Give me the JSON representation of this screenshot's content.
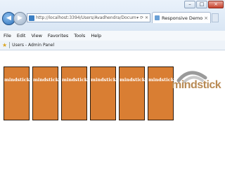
{
  "browser": {
    "url": "http://localhost:3394/Users/Avadhendra/Documents/Visual%20Studio%202010/",
    "tab_title": "Responsive Demo",
    "tab_close": "×",
    "window_controls": {
      "minimize": "–",
      "maximize": "□",
      "close": "×"
    },
    "nav": {
      "back": "◀",
      "forward": "▶"
    },
    "address_icons": "▾ ⟳ ✕"
  },
  "menu": [
    "File",
    "Edit",
    "View",
    "Favorites",
    "Tools",
    "Help"
  ],
  "favorites_bar": {
    "item": "Users - Admin Panel"
  },
  "tiles": [
    {
      "label": "mindstick©"
    },
    {
      "label": "mindstick©"
    },
    {
      "label": "mindstick©"
    },
    {
      "label": "mindstick©"
    },
    {
      "label": "mindstick©"
    },
    {
      "label": "mindstick©"
    }
  ],
  "logo": {
    "text": "mindstick"
  },
  "colors": {
    "tile": "#d97e33",
    "tile_border": "#2b1a0c",
    "logo_text": "#b88a54",
    "logo_arc": "#9a9a9a"
  },
  "icons": [
    "back-icon",
    "forward-icon",
    "page-icon",
    "star-icon",
    "close-icon"
  ]
}
